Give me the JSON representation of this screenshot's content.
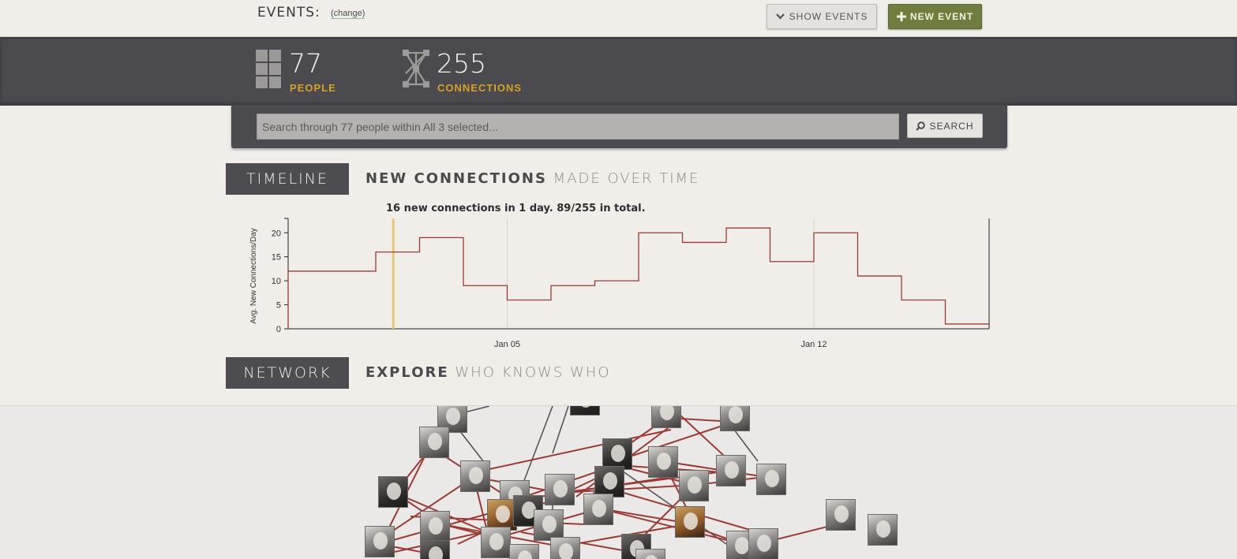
{
  "header": {
    "events_label": "EVENTS:",
    "change_link": "(change)",
    "show_events_label": "SHOW EVENTS",
    "new_event_label": "NEW EVENT"
  },
  "stats": {
    "people_count": "77",
    "people_label": "PEOPLE",
    "connections_count": "255",
    "connections_label": "CONNECTIONS"
  },
  "search": {
    "placeholder": "Search through 77 people within All 3 selected...",
    "button_label": "SEARCH"
  },
  "timeline": {
    "tag": "TIMELINE",
    "title_bold": "NEW CONNECTIONS",
    "title_light": " MADE OVER TIME",
    "annotation": "16 new connections in 1 day. 89/255 in total."
  },
  "network": {
    "tag": "NETWORK",
    "title_bold": "EXPLORE",
    "title_light": " WHO KNOWS WHO"
  },
  "colors": {
    "accent_gold": "#d99f2a",
    "new_event_green": "#6f7d3f",
    "step_line": "#9b3a35",
    "highlight_marker": "#e8c77a",
    "network_edge_red": "#9b3a35",
    "network_edge_gray": "#555555"
  },
  "icons": {
    "show_events": "chevron-down-icon",
    "new_event": "plus-icon",
    "people": "grid-icon",
    "connections": "network-icon",
    "search": "search-icon"
  },
  "chart_data": {
    "type": "line",
    "step": true,
    "ylabel": "Avg. New Connections/Day",
    "ylim": [
      0,
      23
    ],
    "yticks": [
      0,
      5,
      10,
      15,
      20
    ],
    "x_tick_labels": [
      "Jan 05",
      "Jan 12"
    ],
    "x_day_range": [
      0,
      16
    ],
    "x_tick_positions_day": [
      5,
      12
    ],
    "highlight_day": 2.4,
    "series": [
      {
        "steps_start_day": [
          0,
          2,
          3,
          4,
          5,
          6,
          7,
          8,
          9,
          10,
          11,
          12,
          13,
          14,
          15
        ],
        "values": [
          12,
          16,
          19,
          9,
          6,
          9,
          10,
          20,
          18,
          21,
          14,
          20,
          11,
          6,
          1
        ]
      }
    ],
    "grid_x": true,
    "grid_y": false
  }
}
